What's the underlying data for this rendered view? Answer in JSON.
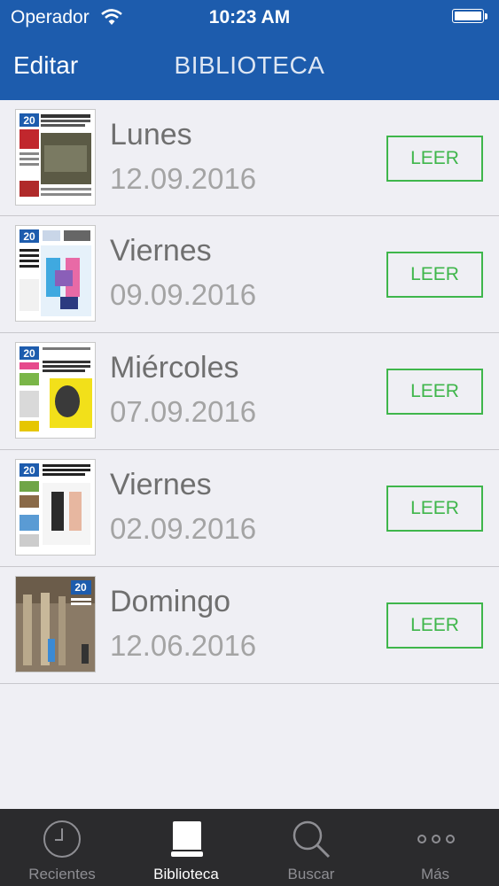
{
  "status_bar": {
    "carrier": "Operador",
    "time": "10:23 AM"
  },
  "nav": {
    "edit_label": "Editar",
    "title": "BIBLIOTECA"
  },
  "read_label": "LEER",
  "issues": [
    {
      "day": "Lunes",
      "date": "12.09.2016",
      "masthead": "20"
    },
    {
      "day": "Viernes",
      "date": "09.09.2016",
      "masthead": "20"
    },
    {
      "day": "Miércoles",
      "date": "07.09.2016",
      "masthead": "20"
    },
    {
      "day": "Viernes",
      "date": "02.09.2016",
      "masthead": "20"
    },
    {
      "day": "Domingo",
      "date": "12.06.2016",
      "masthead": "20"
    }
  ],
  "tabs": [
    {
      "label": "Recientes",
      "icon": "clock-icon",
      "active": false
    },
    {
      "label": "Biblioteca",
      "icon": "book-icon",
      "active": true
    },
    {
      "label": "Buscar",
      "icon": "search-icon",
      "active": false
    },
    {
      "label": "Más",
      "icon": "more-icon",
      "active": false
    }
  ],
  "colors": {
    "header": "#1d5cad",
    "accent": "#3fb64b",
    "tab_bar": "#2b2b2d"
  }
}
